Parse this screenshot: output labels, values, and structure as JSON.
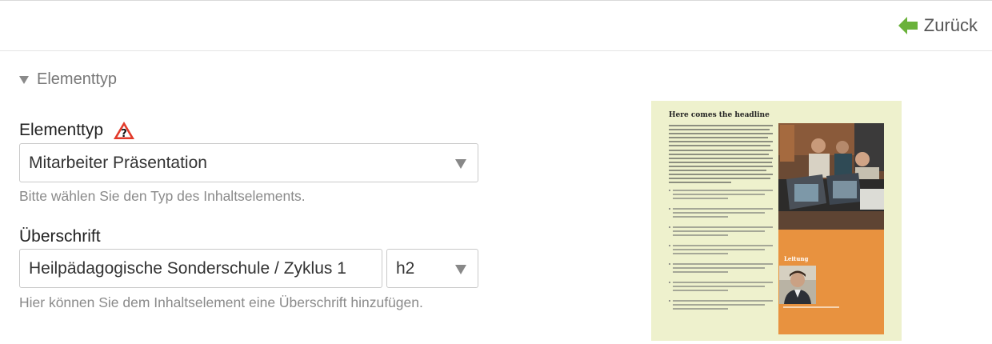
{
  "header": {
    "back_label": "Zurück"
  },
  "section": {
    "title": "Elementtyp"
  },
  "element_type": {
    "label": "Elementtyp",
    "value": "Mitarbeiter Präsentation",
    "help": "Bitte wählen Sie den Typ des Inhaltselements."
  },
  "heading": {
    "label": "Überschrift",
    "value": "Heilpädagogische Sonderschule / Zyklus 1",
    "level": "h2",
    "help": "Hier können Sie dem Inhaltselement eine Überschrift hinzufügen."
  },
  "preview": {
    "headline": "Here comes the headline",
    "leitung_label": "Leitung"
  },
  "colors": {
    "back_icon": "#6ab23a",
    "preview_bg": "#eef1cd",
    "preview_accent": "#e8923f"
  }
}
